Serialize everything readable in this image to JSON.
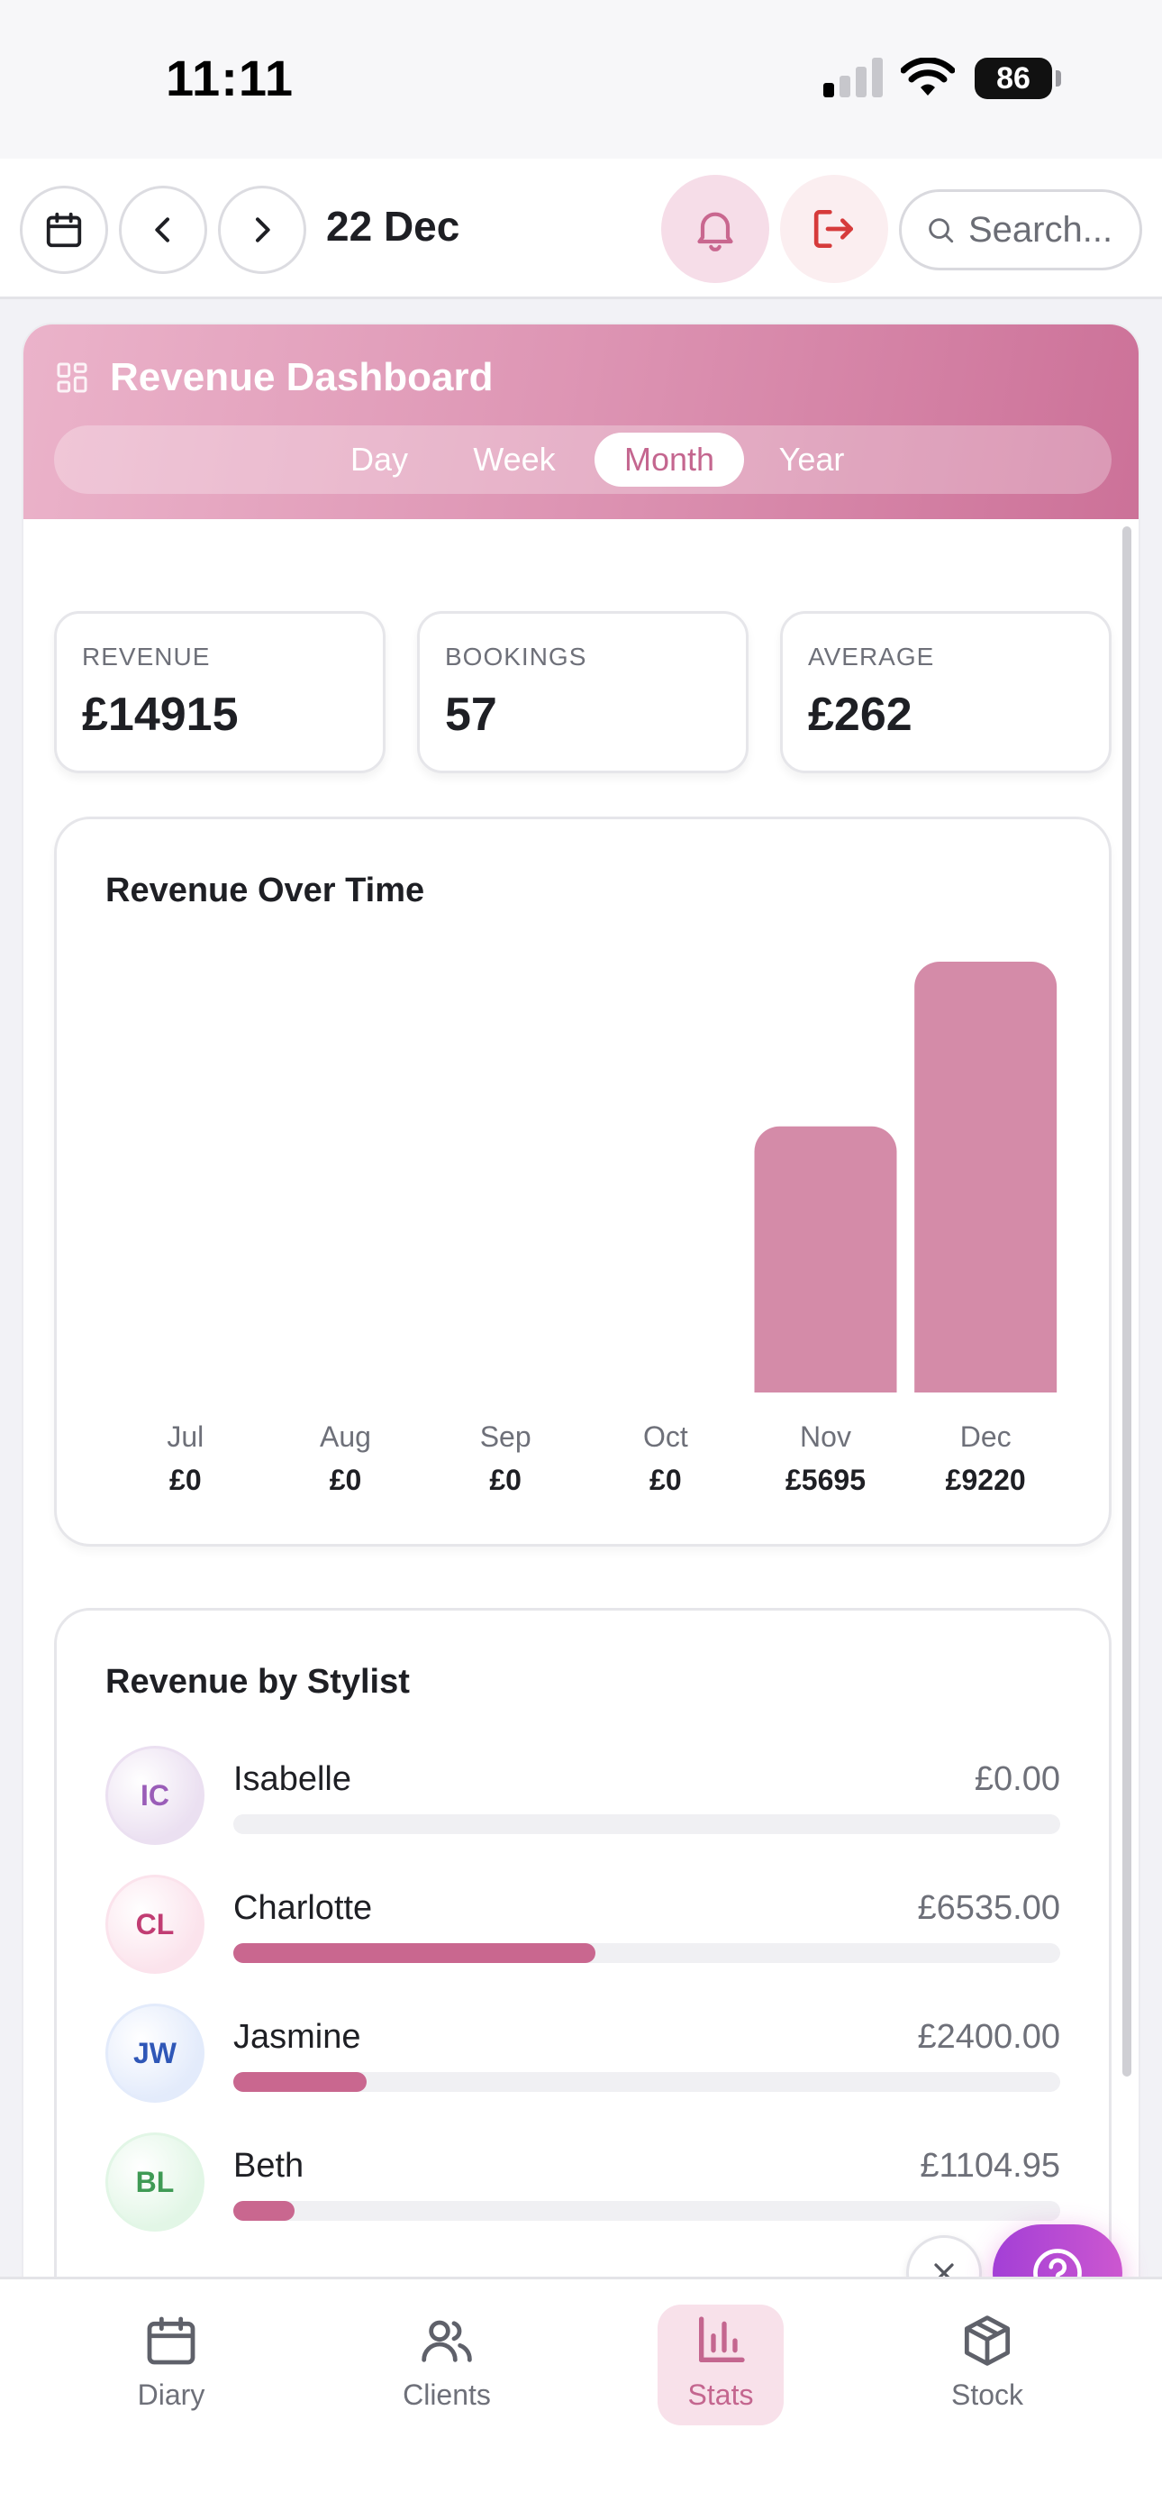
{
  "status_bar": {
    "time": "11:11",
    "battery": "86"
  },
  "topbar": {
    "date": "22 Dec",
    "search_placeholder": "Search..."
  },
  "dashboard": {
    "title": "Revenue Dashboard",
    "periods": [
      "Day",
      "Week",
      "Month",
      "Year"
    ],
    "active_period": "Month"
  },
  "stats": [
    {
      "label": "REVENUE",
      "value": "£14915"
    },
    {
      "label": "BOOKINGS",
      "value": "57"
    },
    {
      "label": "AVERAGE",
      "value": "£262"
    }
  ],
  "revenue_chart": {
    "title": "Revenue Over Time"
  },
  "chart_data": {
    "type": "bar",
    "title": "Revenue Over Time",
    "categories": [
      "Jul",
      "Aug",
      "Sep",
      "Oct",
      "Nov",
      "Dec"
    ],
    "values": [
      0,
      0,
      0,
      0,
      5695,
      9220
    ],
    "value_labels": [
      "£0",
      "£0",
      "£0",
      "£0",
      "£5695",
      "£9220"
    ],
    "ylim": [
      0,
      9220
    ],
    "grid": false,
    "bar_color": "#d48ba8"
  },
  "stylists": {
    "title": "Revenue by Stylist",
    "items": [
      {
        "initials": "IC",
        "name": "Isabelle",
        "amount": "£0.00",
        "share": 0.0,
        "avatar_bg": "#ebe0f1",
        "avatar_fg": "#9a5db8"
      },
      {
        "initials": "CL",
        "name": "Charlotte",
        "amount": "£6535.00",
        "share": 0.438,
        "avatar_bg": "#fbe3ec",
        "avatar_fg": "#c13d73"
      },
      {
        "initials": "JW",
        "name": "Jasmine",
        "amount": "£2400.00",
        "share": 0.161,
        "avatar_bg": "#e3ebfb",
        "avatar_fg": "#2f57b7"
      },
      {
        "initials": "BL",
        "name": "Beth",
        "amount": "£1104.95",
        "share": 0.074,
        "avatar_bg": "#e2f6e6",
        "avatar_fg": "#3f9a55"
      }
    ]
  },
  "tabs": [
    {
      "label": "Diary",
      "icon": "calendar-icon"
    },
    {
      "label": "Clients",
      "icon": "users-icon"
    },
    {
      "label": "Stats",
      "icon": "bar-chart-icon"
    },
    {
      "label": "Stock",
      "icon": "box-icon"
    }
  ],
  "active_tab": "Stats",
  "colors": {
    "accent": "#c9678f",
    "header_gradient_start": "#ebb3ca",
    "header_gradient_end": "#cc7198",
    "help_button": "#a33fd6",
    "logout_icon": "#d63b3b"
  }
}
